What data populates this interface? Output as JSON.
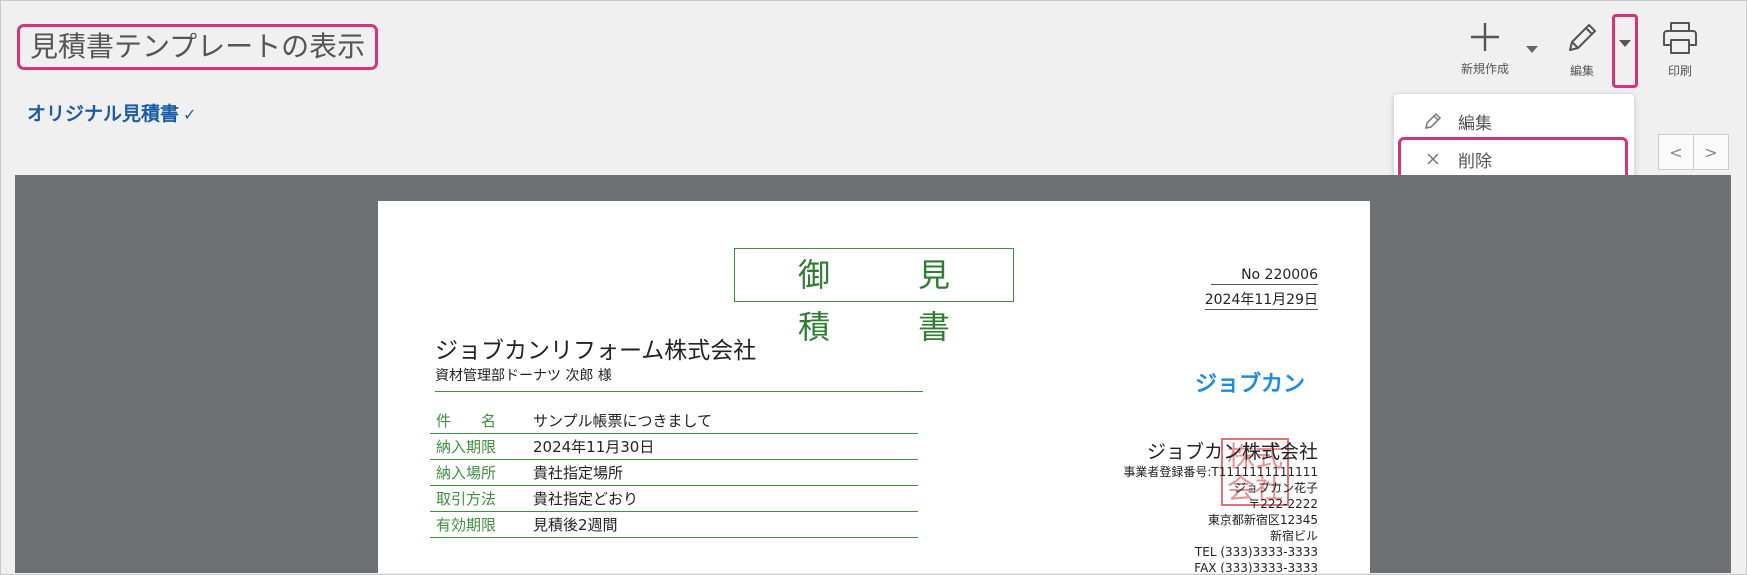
{
  "page": {
    "title": "見積書テンプレートの表示"
  },
  "template": {
    "name": "オリジナル見積書",
    "chevron": "✓"
  },
  "toolbar": {
    "new_label": "新規作成",
    "edit_label": "編集",
    "print_label": "印刷"
  },
  "menu": {
    "edit_label": "編集",
    "delete_label": "削除"
  },
  "pager": {
    "prev": "<",
    "next": ">"
  },
  "document": {
    "title": "御　見　積　書",
    "no": "No 220006",
    "date": "2024年11月29日",
    "client_name": "ジョブカンリフォーム株式会社",
    "client_person": "資材管理部ドーナツ 次郎 様",
    "fields": [
      {
        "key": "件　　名",
        "value": "サンプル帳票につきまして"
      },
      {
        "key": "納入期限",
        "value": "2024年11月30日"
      },
      {
        "key": "納入場所",
        "value": "貴社指定場所"
      },
      {
        "key": "取引方法",
        "value": "貴社指定どおり"
      },
      {
        "key": "有効期限",
        "value": "見積後2週間"
      }
    ],
    "logo_text": "ジョブカン",
    "seal_text": "株式会社",
    "issuer": {
      "company": "ジョブカン株式会社",
      "registration": "事業者登録番号:T1111111111111",
      "person": "ジョブカン花子",
      "postal": "〒222-2222",
      "address": "東京都新宿区12345",
      "building": "新宿ビル",
      "tel": "TEL (333)3333-3333",
      "fax": "FAX (333)3333-3333"
    }
  },
  "colors": {
    "highlight": "#d6317a",
    "accent": "#1a5ca8",
    "doc_green": "#3e8f3e",
    "viewer_bg": "#6e7174"
  }
}
